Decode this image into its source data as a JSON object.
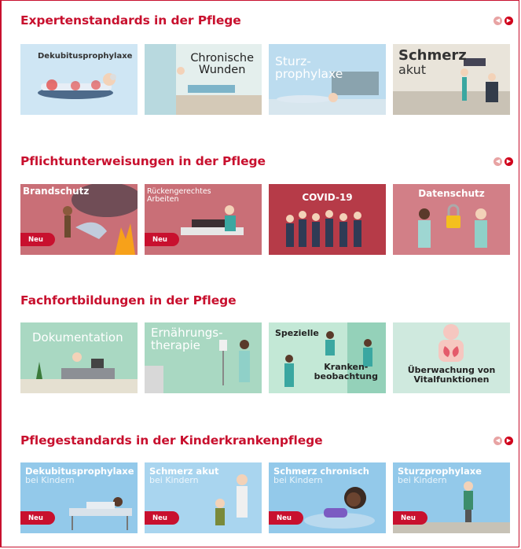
{
  "sections": [
    {
      "title": "Expertenstandards in der Pflege",
      "has_nav": true,
      "cards": [
        {
          "label_lines": [
            "Dekubitusprophylaxe"
          ]
        },
        {
          "label_lines": [
            "Chronische",
            "Wunden"
          ]
        },
        {
          "label_lines": [
            "Sturz-",
            "prophylaxe"
          ]
        },
        {
          "label_lines": [
            "Schmerz",
            "akut"
          ]
        }
      ]
    },
    {
      "title": "Pflichtunterweisungen in der Pflege",
      "has_nav": true,
      "cards": [
        {
          "label_lines": [
            "Brandschutz"
          ],
          "badge": "Neu"
        },
        {
          "label_lines": [
            "Rückengerechtes",
            "Arbeiten"
          ],
          "badge": "Neu"
        },
        {
          "label_lines": [
            "COVID-19"
          ]
        },
        {
          "label_lines": [
            "Datenschutz"
          ]
        }
      ]
    },
    {
      "title": "Fachfortbildungen in der Pflege",
      "has_nav": false,
      "cards": [
        {
          "label_lines": [
            "Dokumentation"
          ]
        },
        {
          "label_lines": [
            "Ernährungs-",
            "therapie"
          ]
        },
        {
          "label_lines": [
            "Spezielle",
            "Kranken-",
            "beobachtung"
          ]
        },
        {
          "label_lines": [
            "Überwachung von",
            "Vitalfunktionen"
          ]
        }
      ]
    },
    {
      "title": "Pflegestandards in der Kinderkrankenpflege",
      "has_nav": true,
      "cards": [
        {
          "label_lines": [
            "Dekubitusprophylaxe",
            "bei Kindern"
          ],
          "badge": "Neu"
        },
        {
          "label_lines": [
            "Schmerz akut",
            "bei Kindern"
          ],
          "badge": "Neu"
        },
        {
          "label_lines": [
            "Schmerz chronisch",
            "bei Kindern"
          ],
          "badge": "Neu"
        },
        {
          "label_lines": [
            "Sturzprophylaxe",
            "bei Kindern"
          ],
          "badge": "Neu"
        }
      ]
    }
  ],
  "nav": {
    "prev_icon": "chevron-left-icon",
    "next_icon": "chevron-right-icon"
  },
  "colors": {
    "accent": "#c8102e",
    "nav_inactive": "#e8a3a3"
  }
}
